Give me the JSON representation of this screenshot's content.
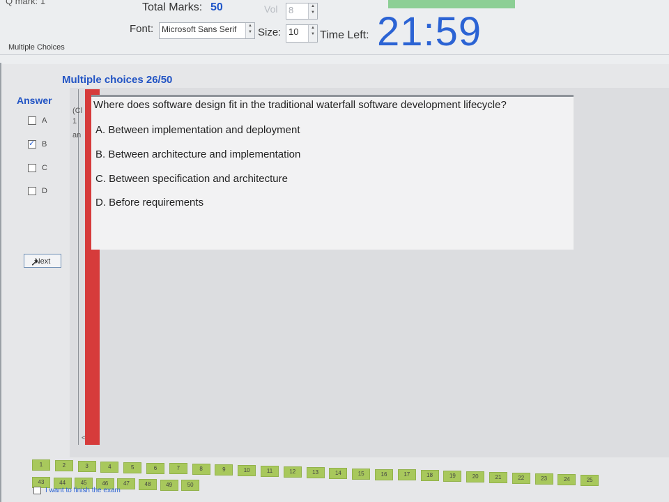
{
  "header": {
    "qmark_label": "Q mark",
    "qmark_value": "1",
    "total_marks_label": "Total Marks:",
    "total_marks_value": "50",
    "vol_label": "Vol",
    "vol_value": "8",
    "font_label": "Font:",
    "font_value": "Microsoft Sans Serif",
    "size_label": "Size:",
    "size_value": "10",
    "time_left_label": "Time Left:",
    "time_left_value": "21:59"
  },
  "tab": {
    "label": "Multiple Choices"
  },
  "main": {
    "section_title": "Multiple choices 26/50",
    "answer_heading": "Answer",
    "options": [
      {
        "label": "A",
        "checked": false
      },
      {
        "label": "B",
        "checked": true
      },
      {
        "label": "C",
        "checked": false
      },
      {
        "label": "D",
        "checked": false
      }
    ],
    "next_label": "Next",
    "side_fragments": [
      "(Cl",
      "1",
      "an"
    ],
    "scroll_arrows": "< >",
    "question": "Where does software design fit in the traditional waterfall software development lifecycle?",
    "answers": [
      "A.  Between implementation and deployment",
      "B.  Between architecture and implementation",
      "C.  Between specification and architecture",
      "D.  Before requirements"
    ]
  },
  "navigator": {
    "row1": [
      "1",
      "2",
      "3",
      "4",
      "5",
      "6",
      "7",
      "8",
      "9",
      "10",
      "11",
      "12",
      "13",
      "14",
      "15",
      "16",
      "17",
      "18",
      "19",
      "20",
      "21",
      "22",
      "23",
      "24",
      "25"
    ],
    "row2": [
      "43",
      "44",
      "45",
      "46",
      "47",
      "48",
      "49",
      "50"
    ],
    "finish_label": "I want to finish the exam"
  },
  "colors": {
    "accent_blue": "#2b63d4",
    "answered_green": "#a8c85c",
    "current_red": "#d63b3b"
  }
}
